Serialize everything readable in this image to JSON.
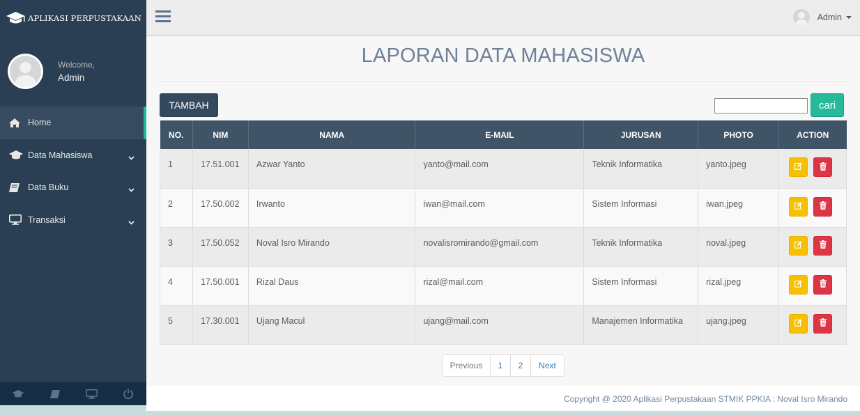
{
  "brand": {
    "title": "APLIKASI PERPUSTAKAAN",
    "icon": "graduation-cap-icon"
  },
  "profile": {
    "welcome": "Welcome,",
    "name": "Admin"
  },
  "menu": [
    {
      "label": "Home",
      "icon": "home-icon",
      "active": true
    },
    {
      "label": "Data Mahasiswa",
      "icon": "graduation-cap-icon",
      "has_children": true
    },
    {
      "label": "Data Buku",
      "icon": "book-icon",
      "has_children": true
    },
    {
      "label": "Transaksi",
      "icon": "desktop-icon",
      "has_children": true
    }
  ],
  "sidebar_footer": [
    "graduation-cap-icon",
    "book-icon",
    "desktop-icon",
    "power-icon"
  ],
  "topnav": {
    "user": "Admin",
    "toggle_icon": "hamburger-icon"
  },
  "page": {
    "title": "LAPORAN DATA MAHASISWA",
    "add_button": "TAMBAH",
    "search_value": "",
    "search_button": "cari"
  },
  "table": {
    "headers": [
      "NO.",
      "NIM",
      "NAMA",
      "E-MAIL",
      "JURUSAN",
      "PHOTO",
      "ACTION"
    ],
    "rows": [
      {
        "no": "1",
        "nim": "17.51.001",
        "nama": "Azwar Yanto",
        "email": "yanto@mail.com",
        "jurusan": "Teknik Informatika",
        "photo": "yanto.jpeg"
      },
      {
        "no": "2",
        "nim": "17.50.002",
        "nama": "Irwanto",
        "email": "iwan@mail.com",
        "jurusan": "Sistem Informasi",
        "photo": "iwan.jpeg"
      },
      {
        "no": "3",
        "nim": "17.50.052",
        "nama": "Noval Isro Mirando",
        "email": "novalisromirando@gmail.com",
        "jurusan": "Teknik Informatika",
        "photo": "noval.jpeg"
      },
      {
        "no": "4",
        "nim": "17.50.001",
        "nama": "Rizal Daus",
        "email": "rizal@mail.com",
        "jurusan": "Sistem Informasi",
        "photo": "rizal.jpeg"
      },
      {
        "no": "5",
        "nim": "17.30.001",
        "nama": "Ujang Macul",
        "email": "ujang@mail.com",
        "jurusan": "Manajemen Informatika",
        "photo": "ujang.jpeg"
      }
    ]
  },
  "pagination": {
    "previous": "Previous",
    "pages": [
      "1",
      "2"
    ],
    "next": "Next"
  },
  "footer": {
    "copyright": "Copyright @ 2020 Aplikasi Perpustakaan STMIK PPKIA : Noval Isro Mirando"
  },
  "colors": {
    "sidebar": "#2a3f54",
    "accent": "#1abb9c",
    "edit": "#f7c000",
    "delete": "#dc3545",
    "header": "#405467"
  }
}
